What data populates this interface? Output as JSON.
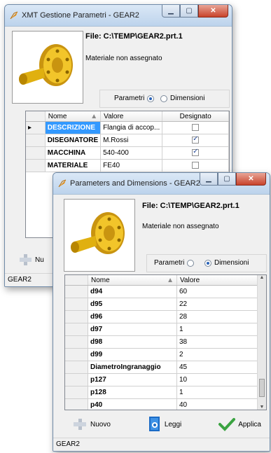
{
  "win1": {
    "title": "XMT Gestione Parametri - GEAR2",
    "file": "File: C:\\TEMP\\GEAR2.prt.1",
    "material": "Materiale non assegnato",
    "radio_params": "Parametri",
    "radio_dims": "Dimensioni",
    "radio_selected": "Parametri",
    "columns": [
      "Nome",
      "Valore",
      "Designato"
    ],
    "rows": [
      {
        "name": "DESCRIZIONE",
        "value": "Flangia di accop...",
        "designated": false
      },
      {
        "name": "DISEGNATORE",
        "value": "M.Rossi",
        "designated": true
      },
      {
        "name": "MACCHINA",
        "value": "540-400",
        "designated": true
      },
      {
        "name": "MATERIALE",
        "value": "FE40",
        "designated": false
      }
    ],
    "new_label": "Nu",
    "status": "GEAR2"
  },
  "win2": {
    "title": "Parameters and Dimensions - GEAR2",
    "file": "File: C:\\TEMP\\GEAR2.prt.1",
    "material": "Materiale non assegnato",
    "radio_params": "Parametri",
    "radio_dims": "Dimensioni",
    "radio_selected": "Dimensioni",
    "columns": [
      "Nome",
      "Valore"
    ],
    "rows": [
      {
        "name": "d94",
        "value": "60"
      },
      {
        "name": "d95",
        "value": "22"
      },
      {
        "name": "d96",
        "value": "28"
      },
      {
        "name": "d97",
        "value": "1"
      },
      {
        "name": "d98",
        "value": "38"
      },
      {
        "name": "d99",
        "value": "2"
      },
      {
        "name": "DiametroIngranaggio",
        "value": "45"
      },
      {
        "name": "p127",
        "value": "10"
      },
      {
        "name": "p128",
        "value": "1"
      },
      {
        "name": "p40",
        "value": "40"
      }
    ],
    "btn_new": "Nuovo",
    "btn_read": "Leggi",
    "btn_apply": "Applica",
    "status": "GEAR2"
  },
  "colors": {
    "accent": "#3399ff",
    "check": "#3aa341",
    "gear": "#e0b010"
  }
}
